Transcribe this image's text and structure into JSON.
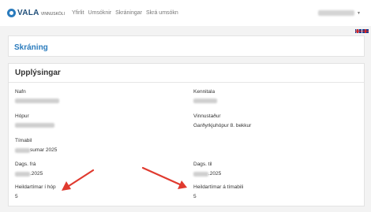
{
  "navbar": {
    "logo_text": "VALA",
    "logo_sub": "VINNUSKÓLI",
    "links": [
      "Yfirlit",
      "Umsóknir",
      "Skráningar",
      "Skrá umsókn"
    ],
    "user_caret": "▼"
  },
  "page": {
    "title": "Skráning"
  },
  "info": {
    "title": "Upplýsingar",
    "fields": {
      "nafn": {
        "label": "Nafn",
        "value": ""
      },
      "kennitala": {
        "label": "Kennitala",
        "value": ""
      },
      "hopur": {
        "label": "Hópur",
        "value": ""
      },
      "vinnustadur": {
        "label": "Vinnustaður",
        "value": "Garðyrkjuhópur 8. bekkur"
      },
      "timabil": {
        "label": "Tímabil",
        "value_suffix": "sumar 2025"
      },
      "dags_fra": {
        "label": "Dags. frá",
        "value_suffix": ".2025"
      },
      "dags_til": {
        "label": "Dags. til",
        "value_suffix": ".2025"
      },
      "heild_hop": {
        "label": "Heildartímar í hóp",
        "value": "5"
      },
      "heild_timabili": {
        "label": "Heildartímar á tímabili",
        "value": "5"
      }
    }
  },
  "colors": {
    "accent": "#2a7bbd",
    "arrow": "#e03a2f"
  },
  "icons": [
    "flag-is-icon",
    "flag-en-icon",
    "logo-icon"
  ]
}
